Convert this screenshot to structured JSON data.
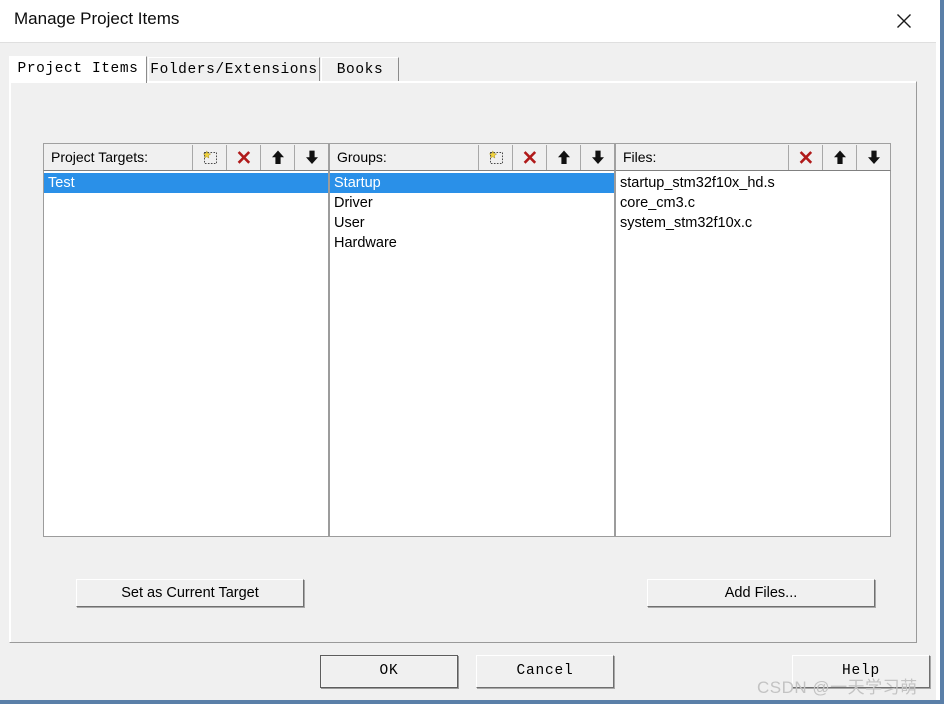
{
  "window": {
    "title": "Manage Project Items",
    "close_icon": "close-icon"
  },
  "tabs": [
    {
      "label": "Project Items",
      "active": true
    },
    {
      "label": "Folders/Extensions",
      "active": false
    },
    {
      "label": "Books",
      "active": false
    }
  ],
  "columns": {
    "targets": {
      "label": "Project Targets:",
      "tools": [
        "new-item-icon",
        "delete-icon",
        "move-up-icon",
        "move-down-icon"
      ],
      "items": [
        {
          "label": "Test",
          "selected": true
        }
      ]
    },
    "groups": {
      "label": "Groups:",
      "tools": [
        "new-item-icon",
        "delete-icon",
        "move-up-icon",
        "move-down-icon"
      ],
      "items": [
        {
          "label": "Startup",
          "selected": true
        },
        {
          "label": "Driver",
          "selected": false
        },
        {
          "label": "User",
          "selected": false
        },
        {
          "label": "Hardware",
          "selected": false
        }
      ]
    },
    "files": {
      "label": "Files:",
      "tools": [
        "delete-icon",
        "move-up-icon",
        "move-down-icon"
      ],
      "items": [
        {
          "label": "startup_stm32f10x_hd.s",
          "selected": false
        },
        {
          "label": "core_cm3.c",
          "selected": false
        },
        {
          "label": "system_stm32f10x.c",
          "selected": false
        }
      ]
    }
  },
  "actions": {
    "set_as_current_target": "Set as Current Target",
    "add_files": "Add Files..."
  },
  "dialog_buttons": {
    "ok": "OK",
    "cancel": "Cancel",
    "help": "Help"
  },
  "watermark": "CSDN @一天学习萌",
  "colors": {
    "selection_blue": "#2a90e8",
    "delete_red": "#b01a1a",
    "face": "#f0f0f0",
    "window_edge": "#5a7fa8",
    "watermark_gray": "#c3c3c3"
  }
}
